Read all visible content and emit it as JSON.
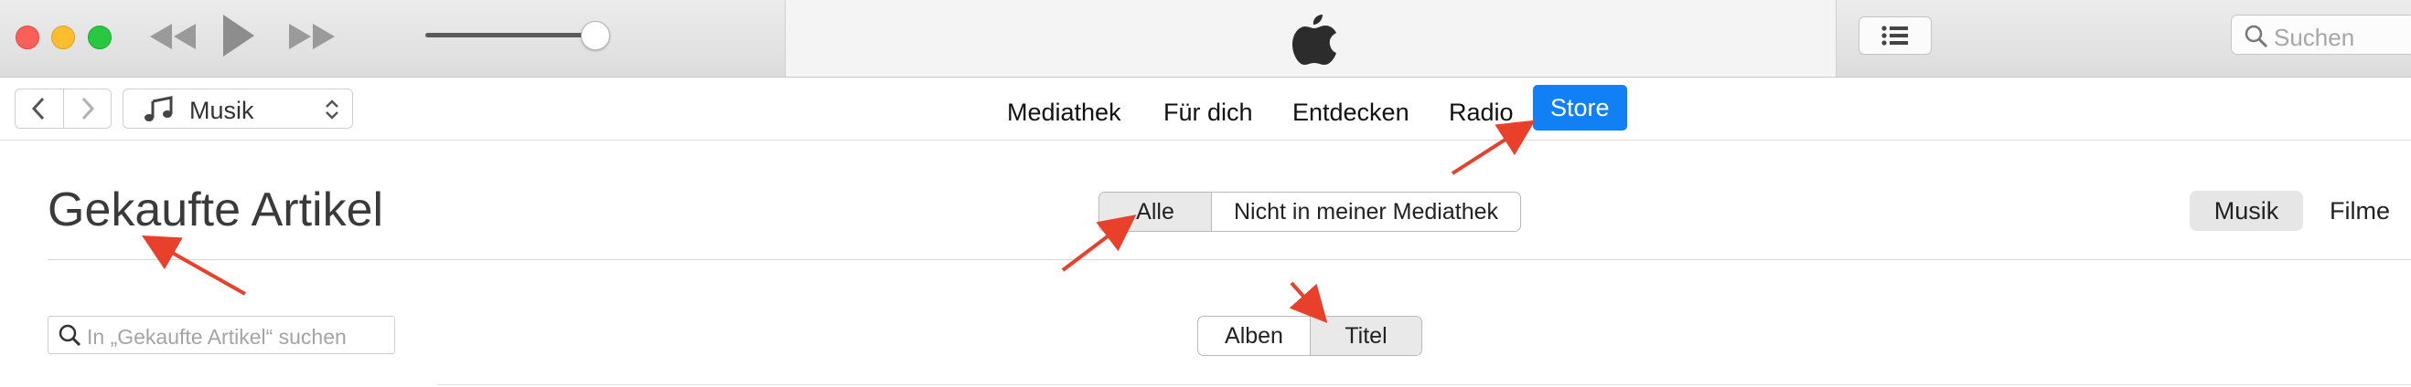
{
  "window": {
    "controls": [
      "close",
      "minimize",
      "zoom"
    ],
    "playback": [
      "rewind-icon",
      "play-icon",
      "fast-forward-icon"
    ],
    "volume_level": 0.9,
    "lcd_icon": "apple-logo",
    "list_icon": "list-icon",
    "search_placeholder": "Suchen"
  },
  "nav": {
    "back_icon": "chevron-left-icon",
    "forward_icon": "chevron-right-icon",
    "media_icon": "music-note-icon",
    "media_label": "Musik",
    "tabs": [
      "Mediathek",
      "Für dich",
      "Entdecken",
      "Radio",
      "Store"
    ],
    "active_tab": "Store"
  },
  "content": {
    "title": "Gekaufte Artikel",
    "filter": {
      "options": [
        "Alle",
        "Nicht in meiner Mediathek"
      ],
      "selected": "Alle"
    },
    "media_types": {
      "options": [
        "Musik",
        "Filme"
      ],
      "selected": "Musik"
    },
    "search_placeholder": "In „Gekaufte Artikel“ suchen",
    "view": {
      "options": [
        "Alben",
        "Titel"
      ],
      "selected": "Titel"
    }
  },
  "annotations": {
    "arrow_color": "#e8402a",
    "count": 5
  },
  "colors": {
    "accent": "#1180f5",
    "toolbar": "#e3e3e3"
  }
}
